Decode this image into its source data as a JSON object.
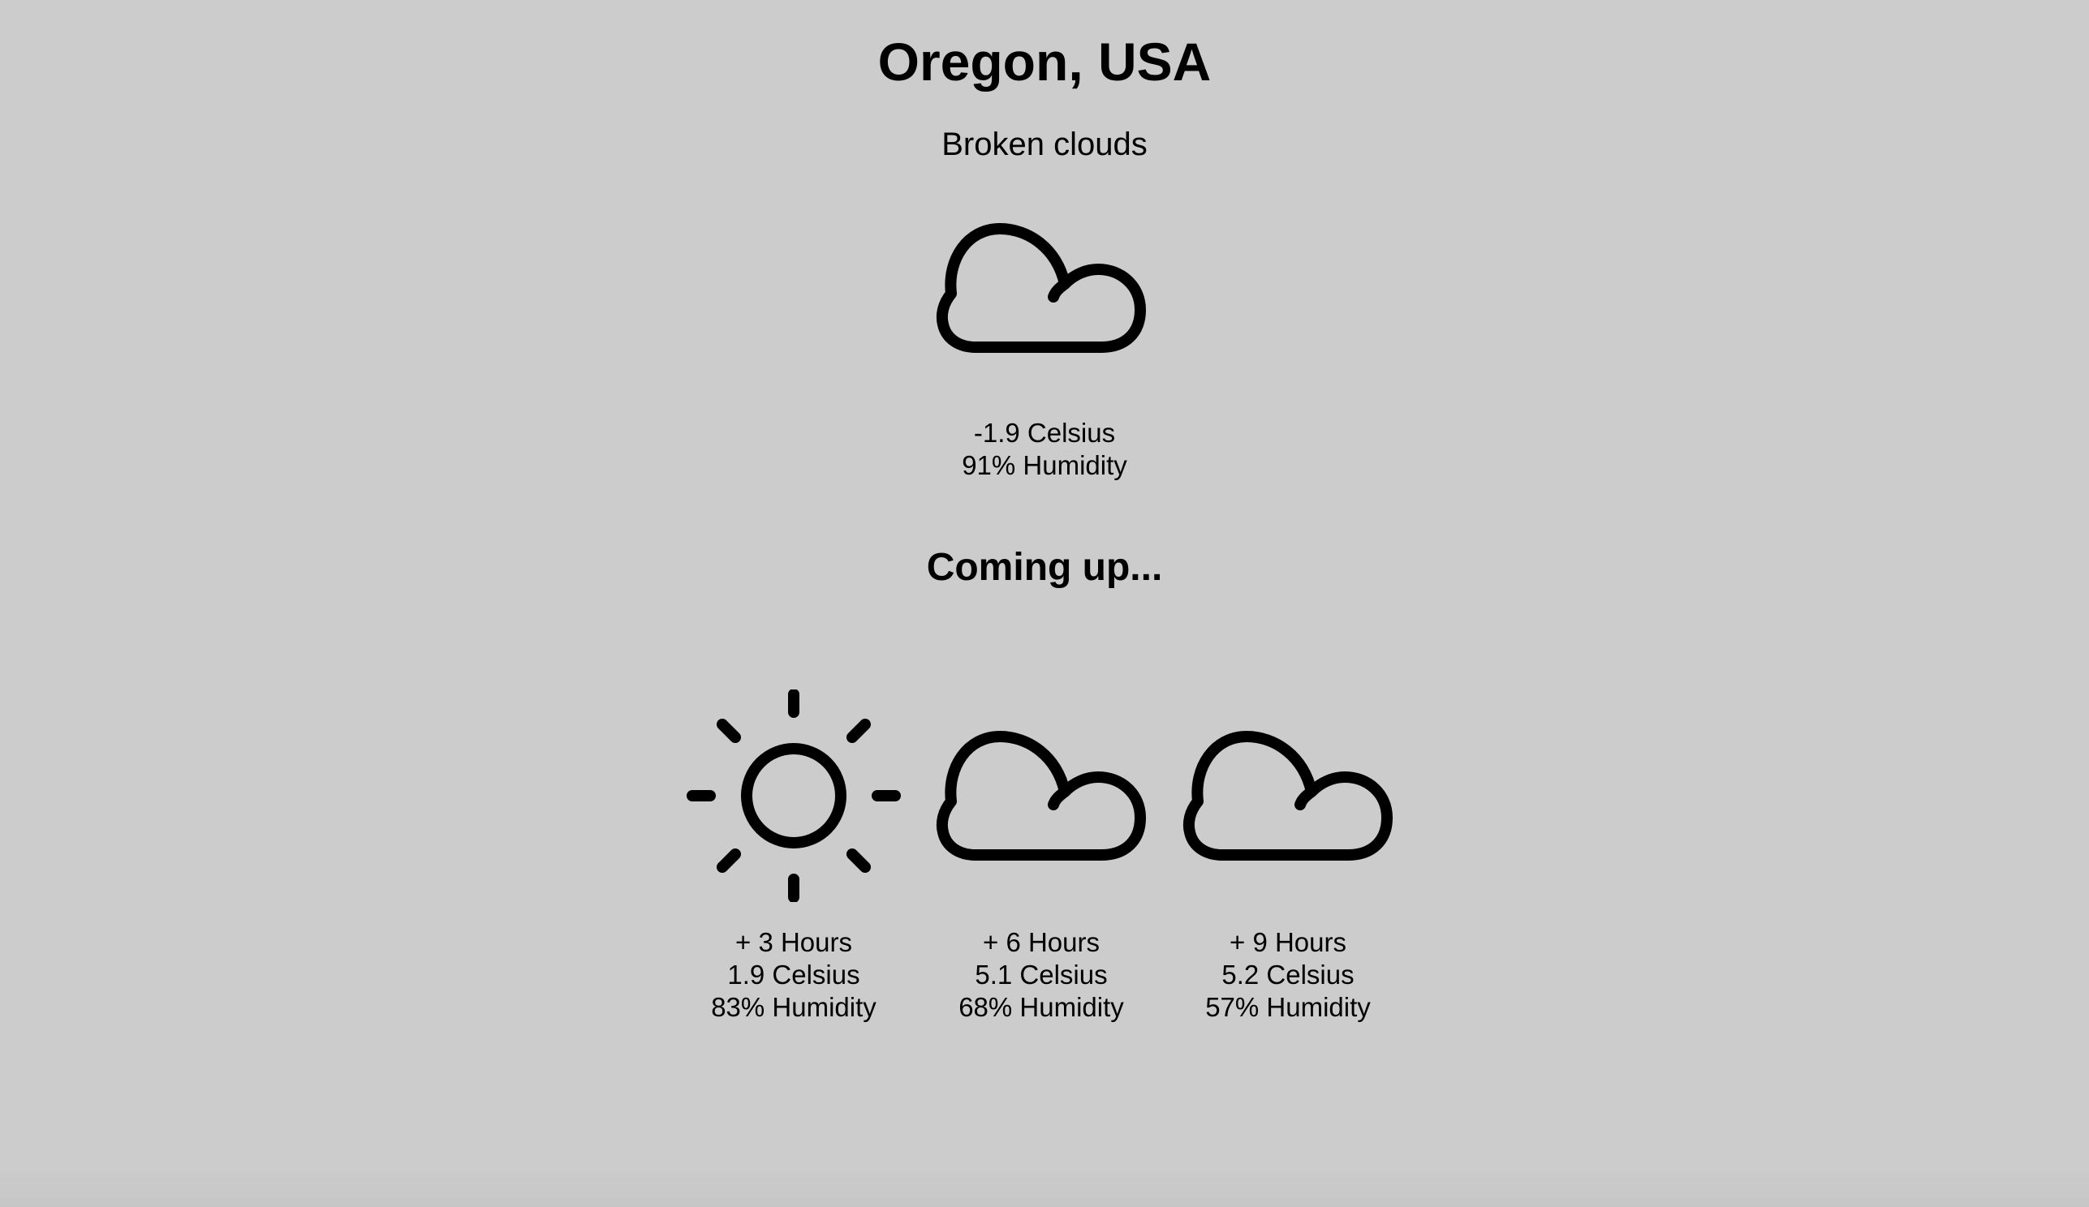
{
  "location": "Oregon, USA",
  "current": {
    "condition": "Broken clouds",
    "icon": "cloud-icon",
    "temperature": "-1.9 Celsius",
    "humidity": "91% Humidity"
  },
  "forecast_heading": "Coming up...",
  "forecast": [
    {
      "icon": "sun-icon",
      "offset": "+ 3 Hours",
      "temperature": "1.9 Celsius",
      "humidity": "83% Humidity"
    },
    {
      "icon": "cloud-icon",
      "offset": "+ 6 Hours",
      "temperature": "5.1 Celsius",
      "humidity": "68% Humidity"
    },
    {
      "icon": "cloud-icon",
      "offset": "+ 9 Hours",
      "temperature": "5.2 Celsius",
      "humidity": "57% Humidity"
    }
  ],
  "colors": {
    "background": "#cccccc",
    "text": "#000000"
  }
}
